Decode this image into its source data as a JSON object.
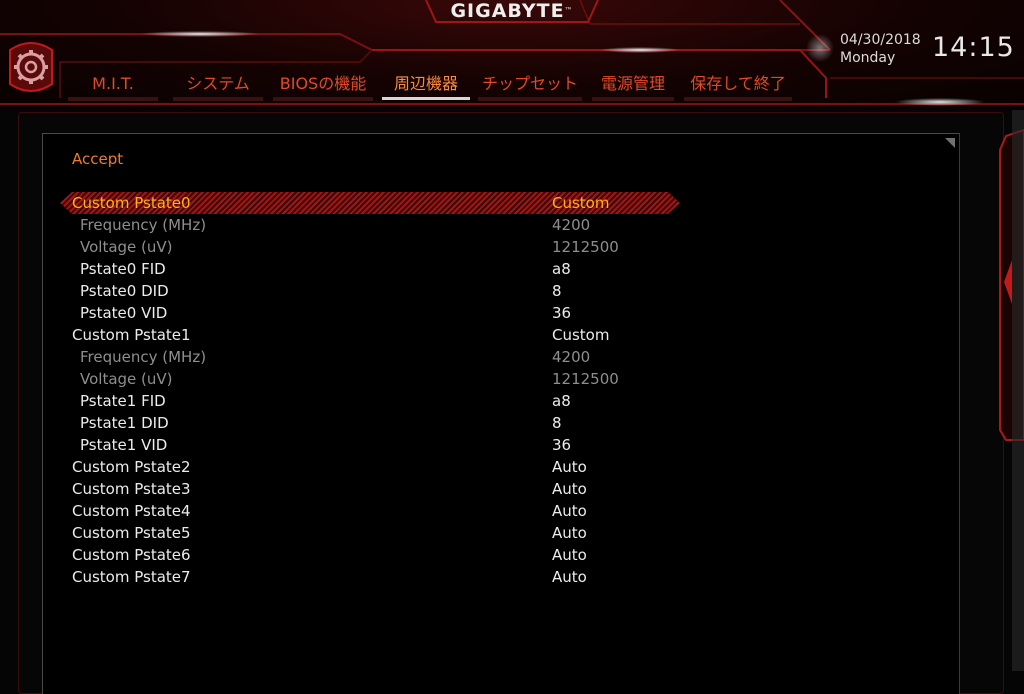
{
  "brand": {
    "name": "GIGABYTE",
    "tm": "™"
  },
  "datetime": {
    "date": "04/30/2018",
    "day": "Monday",
    "time": "14:15"
  },
  "tabs": [
    {
      "label": "M.I.T."
    },
    {
      "label": "システム"
    },
    {
      "label": "BIOSの機能"
    },
    {
      "label": "周辺機器"
    },
    {
      "label": "チップセット"
    },
    {
      "label": "電源管理"
    },
    {
      "label": "保存して終了"
    }
  ],
  "active_tab": "周辺機器",
  "panel": {
    "heading": "Accept"
  },
  "settings": [
    {
      "label": "Custom Pstate0",
      "value": "Custom"
    },
    {
      "label": "Frequency (MHz)",
      "value": "4200"
    },
    {
      "label": "Voltage (uV)",
      "value": "1212500"
    },
    {
      "label": "Pstate0 FID",
      "value": "a8"
    },
    {
      "label": "Pstate0 DID",
      "value": "8"
    },
    {
      "label": "Pstate0 VID",
      "value": "36"
    },
    {
      "label": "Custom Pstate1",
      "value": "Custom"
    },
    {
      "label": "Frequency (MHz)",
      "value": "4200"
    },
    {
      "label": "Voltage (uV)",
      "value": "1212500"
    },
    {
      "label": "Pstate1 FID",
      "value": "a8"
    },
    {
      "label": "Pstate1 DID",
      "value": "8"
    },
    {
      "label": "Pstate1 VID",
      "value": "36"
    },
    {
      "label": "Custom Pstate2",
      "value": "Auto"
    },
    {
      "label": "Custom Pstate3",
      "value": "Auto"
    },
    {
      "label": "Custom Pstate4",
      "value": "Auto"
    },
    {
      "label": "Custom Pstate5",
      "value": "Auto"
    },
    {
      "label": "Custom Pstate6",
      "value": "Auto"
    },
    {
      "label": "Custom Pstate7",
      "value": "Auto"
    }
  ],
  "colors": {
    "accent_orange": "#f07a28",
    "selected_text": "#ffb21a",
    "disabled_text": "#8e8e8e",
    "tab_text": "#e04a28",
    "brand_red": "#c81818"
  }
}
